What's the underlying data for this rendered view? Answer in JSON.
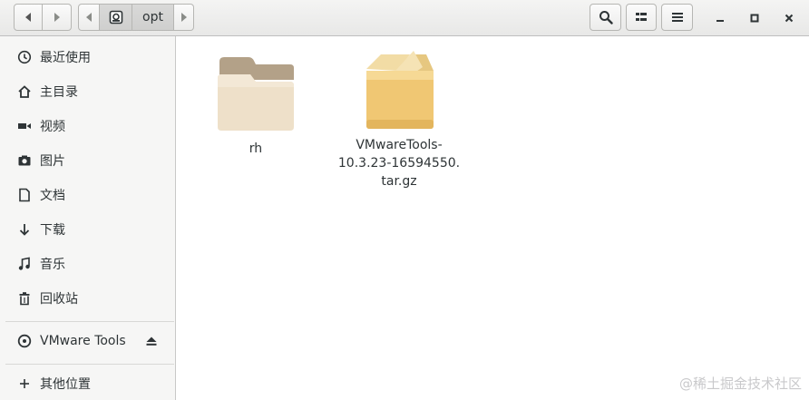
{
  "header": {
    "path": [
      "opt"
    ],
    "back_icon": "chevron-left-icon",
    "forward_icon": "chevron-right-icon",
    "search_icon": "search-icon",
    "view_icon": "list-view-icon",
    "menu_icon": "hamburger-menu-icon"
  },
  "sidebar": {
    "items": [
      {
        "label": "最近使用",
        "icon": "recent-clock-icon"
      },
      {
        "label": "主目录",
        "icon": "home-icon"
      },
      {
        "label": "视频",
        "icon": "video-camera-icon"
      },
      {
        "label": "图片",
        "icon": "camera-icon"
      },
      {
        "label": "文档",
        "icon": "document-icon"
      },
      {
        "label": "下载",
        "icon": "download-arrow-icon"
      },
      {
        "label": "音乐",
        "icon": "music-note-icon"
      },
      {
        "label": "回收站",
        "icon": "trash-icon"
      }
    ],
    "devices": [
      {
        "label": "VMware Tools",
        "icon": "disc-icon",
        "action_icon": "eject-icon"
      }
    ],
    "other": {
      "label": "其他位置",
      "icon": "plus-icon"
    }
  },
  "files": [
    {
      "name": "rh",
      "type": "folder"
    },
    {
      "name_lines": [
        "VMwareTools-",
        "10.3.23-16594550.",
        "tar.gz"
      ],
      "type": "archive"
    }
  ],
  "watermark": "@稀土掘金技术社区"
}
